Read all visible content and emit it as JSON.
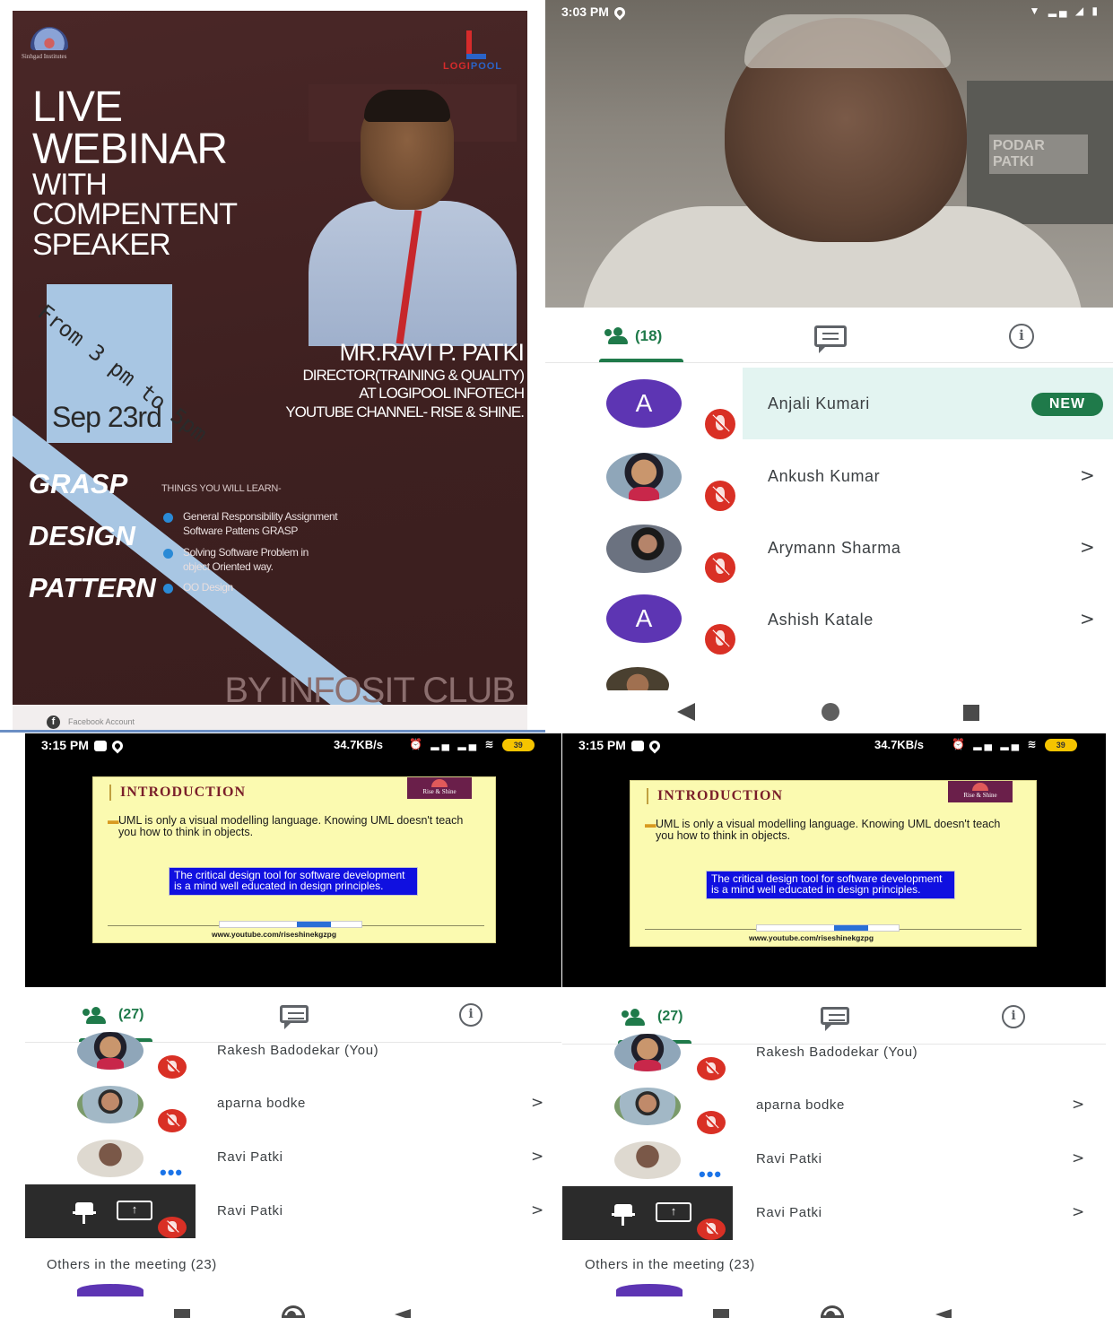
{
  "poster": {
    "institute_text": "Sinhgad Institutes",
    "brand_left": "LOGI",
    "brand_right": "POOL",
    "title_line1": "LIVE",
    "title_line2": "WEBINAR",
    "title_line3": "WITH",
    "title_line4": "COMPENTENT",
    "title_line5": "SPEAKER",
    "band_text": "From 3 pm to 5pm",
    "date": "Sep 23rd",
    "speaker_name": "MR.RAVI P. PATKI",
    "speaker_line1": "DIRECTOR(TRAINING & QUALITY)",
    "speaker_line2": "AT LOGIPOOL INFOTECH",
    "speaker_line3": "YOUTUBE CHANNEL- RISE & SHINE.",
    "topic_line1": "GRASP",
    "topic_line2": "DESIGN",
    "topic_line3": "PATTERN",
    "learn_heading": "THINGS YOU WILL LEARN-",
    "learn_items": [
      {
        "line1": "General Responsibility Assignment",
        "line2": "Software Pattens GRASP"
      },
      {
        "line1": "Solving Software Problem in",
        "line2": "object Oriented way."
      },
      {
        "line1": "OO Design",
        "line2": ""
      }
    ],
    "by_text": "BY INFOSIT CLUB",
    "footer_text": "Facebook Account",
    "accent_band_color": "#a8c6e3",
    "background_color": "#4a2727"
  },
  "panel_a": {
    "status": {
      "time": "3:03 PM"
    },
    "video_sign": "PODAR\nPATKI",
    "tabs": {
      "participants_count": "(18)"
    },
    "participants": [
      {
        "name": "Anjali Kumari",
        "avatar": "A",
        "badge": "NEW",
        "muted": true
      },
      {
        "name": "Ankush Kumar",
        "muted": true
      },
      {
        "name": "Arymann Sharma",
        "muted": true
      },
      {
        "name": "Ashish Katale",
        "avatar": "A",
        "muted": true
      }
    ],
    "chevron": ">"
  },
  "panel_b": {
    "status": {
      "time": "3:15 PM",
      "speed": "34.7KB/s",
      "battery": "39"
    },
    "slide": {
      "title": "INTRODUCTION",
      "badge": "Rise & Shine",
      "bullet": "UML is only a visual modelling language. Knowing UML doesn't teach you how to think in objects.",
      "box": "The critical design tool for software development is a mind well educated in design principles.",
      "url": "www.youtube.com/riseshinekgzpg"
    },
    "tabs": {
      "participants_count": "(27)"
    },
    "participants": [
      {
        "name": "Rakesh Badodekar (You)",
        "muted": true
      },
      {
        "name": "aparna bodke",
        "muted": true
      },
      {
        "name": "Ravi Patki",
        "speaking": true
      },
      {
        "name": "Ravi Patki",
        "presenting": true
      }
    ],
    "others_label": "Others in the meeting (23)",
    "chevron": ">",
    "dots": "•••"
  },
  "panel_c": {
    "status": {
      "time": "3:15 PM",
      "speed": "34.7KB/s",
      "battery": "39"
    },
    "slide": {
      "title": "INTRODUCTION",
      "badge": "Rise & Shine",
      "bullet": "UML is only a visual modelling language. Knowing UML doesn't teach you how to think in objects.",
      "box": "The critical design tool for software development is a mind well educated in design principles.",
      "url": "www.youtube.com/riseshinekgzpg"
    },
    "tabs": {
      "participants_count": "(27)"
    },
    "participants": [
      {
        "name": "Rakesh Badodekar (You)",
        "muted": true
      },
      {
        "name": "aparna bodke",
        "muted": true
      },
      {
        "name": "Ravi Patki",
        "speaking": true
      },
      {
        "name": "Ravi Patki",
        "presenting": true
      }
    ],
    "others_label": "Others in the meeting (23)",
    "chevron": ">",
    "dots": "•••"
  },
  "colors": {
    "accent_green": "#1f7a4a",
    "mute_red": "#d93025",
    "avatar_purple": "#5d35b3",
    "highlight_row": "#e3f4f1",
    "slide_yellow": "#fbfab0",
    "slide_box_blue": "#1010e0"
  },
  "icons": [
    "people-icon",
    "chat-icon",
    "info-icon",
    "mic-off-icon",
    "pin-icon",
    "present-screen-icon",
    "nav-home-icon",
    "nav-back-icon",
    "nav-recents-icon"
  ]
}
